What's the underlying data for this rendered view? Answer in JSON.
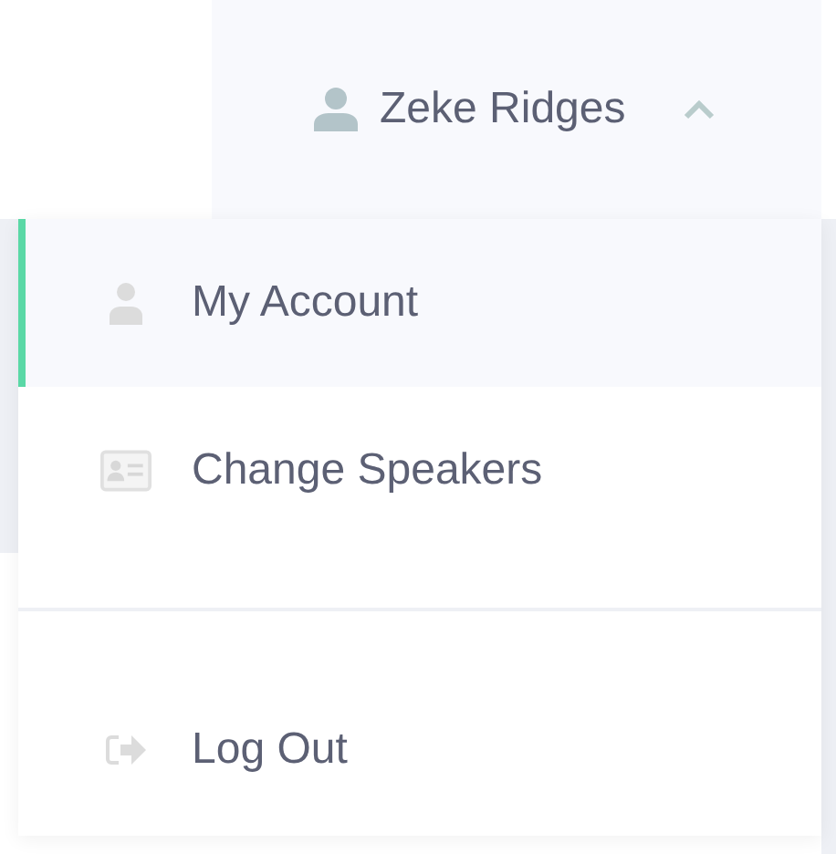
{
  "user_menu": {
    "name": "Zeke Ridges",
    "expanded": true
  },
  "menu": {
    "items": [
      {
        "kind": "account",
        "label": "My Account",
        "selected": true
      },
      {
        "kind": "speakers",
        "label": "Change Speakers",
        "selected": false
      }
    ],
    "footer_items": [
      {
        "kind": "logout",
        "label": "Log Out",
        "selected": false
      }
    ]
  }
}
